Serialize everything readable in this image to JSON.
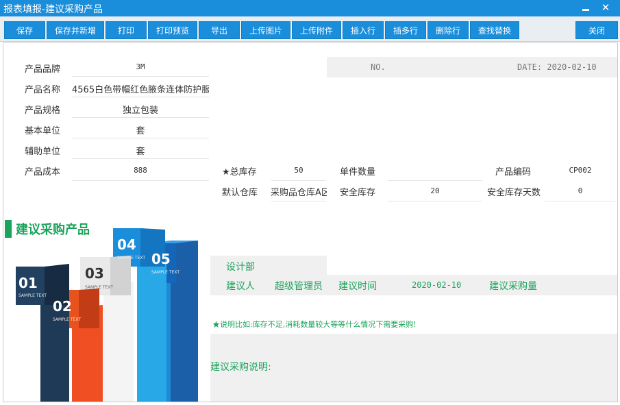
{
  "window": {
    "title": "报表填报-建议采购产品",
    "minimize": "minimize-icon",
    "close": "close-icon"
  },
  "toolbar": {
    "buttons": [
      "保存",
      "保存并新增",
      "打印",
      "打印预览",
      "导出",
      "上传图片",
      "上传附件",
      "插入行",
      "插多行",
      "删除行",
      "查找替换"
    ],
    "close_label": "关闭"
  },
  "header": {
    "no_label": "NO.",
    "date_label": "DATE: 2020-02-10"
  },
  "fields": {
    "brand": {
      "label": "产品品牌",
      "value": "3M"
    },
    "name": {
      "label": "产品名称",
      "value": "4565白色带帽红色腋条连体防护服"
    },
    "spec": {
      "label": "产品规格",
      "value": "独立包装"
    },
    "base_unit": {
      "label": "基本单位",
      "value": "套"
    },
    "aux_unit": {
      "label": "辅助单位",
      "value": "套"
    },
    "cost": {
      "label": "产品成本",
      "value": "888"
    },
    "total_stock": {
      "label": "★总库存",
      "value": "50"
    },
    "unit_qty": {
      "label": "单件数量",
      "value": ""
    },
    "product_code": {
      "label": "产品编码",
      "value": "CP002"
    },
    "default_wh": {
      "label": "默认仓库",
      "value": "采购品仓库A区"
    },
    "safety_stock": {
      "label": "安全库存",
      "value": "20"
    },
    "safety_days": {
      "label": "安全库存天数",
      "value": "0"
    }
  },
  "section": {
    "title": "建议采购产品",
    "dept": "设计部",
    "suggester_label": "建议人",
    "suggester_value": "超级管理员",
    "suggest_time_label": "建议时间",
    "suggest_time_value": "2020-02-10",
    "suggest_qty_label": "建议采购量",
    "note": "★说明比如:库存不足,消耗数量较大等等什么情况下需要采购!",
    "desc_label": "建议采购说明:"
  },
  "illustration": {
    "steps": [
      "01",
      "02",
      "03",
      "04",
      "05"
    ],
    "sample_text": "SAMPLE TEXT"
  },
  "colors": {
    "titlebar": "#1a8ddb",
    "button": "#1a8ddb",
    "accent_green": "#1aa35b"
  }
}
